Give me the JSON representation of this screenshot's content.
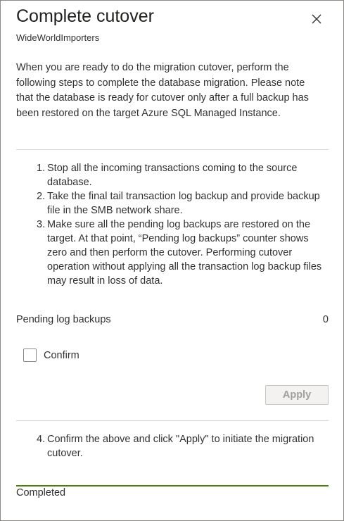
{
  "header": {
    "title": "Complete cutover",
    "subtitle": "WideWorldImporters",
    "close_icon": "close-icon"
  },
  "intro": "When you are ready to do the migration cutover, perform the following steps to complete the database migration. Please note that the database is ready for cutover only after a full backup has been restored on the target Azure SQL Managed Instance.",
  "steps": [
    {
      "num": "1.",
      "text": "Stop all the incoming transactions coming to the source database."
    },
    {
      "num": "2.",
      "text": "Take the final tail transaction log backup and provide backup file in the SMB network share."
    },
    {
      "num": "3.",
      "text": "Make sure all the pending log backups are restored on the target. At that point, “Pending log backups” counter shows zero and then perform the cutover. Performing cutover operation without applying all the transaction log backup files may result in loss of data."
    }
  ],
  "pending": {
    "label": "Pending log backups",
    "value": "0"
  },
  "confirm": {
    "label": "Confirm",
    "checked": false
  },
  "apply": {
    "label": "Apply",
    "disabled": true
  },
  "step4": {
    "num": "4.",
    "text": "Confirm the above and click \"Apply\" to initiate the migration cutover."
  },
  "progress": {
    "percent": 100,
    "color": "#498205"
  },
  "status": "Completed",
  "colors": {
    "divider": "#d6d6d6",
    "text": "#323130",
    "disabled_text": "#a19f9d"
  }
}
